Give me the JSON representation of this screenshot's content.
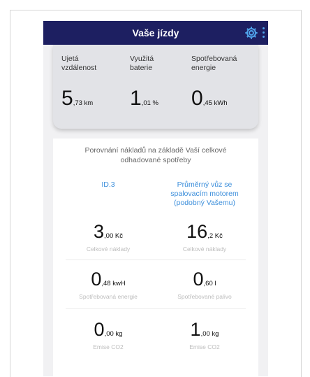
{
  "header": {
    "title": "Vaše jízdy",
    "settings_icon": "gear-icon",
    "more_icon": "kebab-menu-icon",
    "accent_color": "#4fa3ea",
    "bar_color": "#1d1f61"
  },
  "stats": [
    {
      "label_line1": "Ujetá",
      "label_line2": "vzdálenost",
      "value_big": "5",
      "value_small": ",73 km"
    },
    {
      "label_line1": "Využitá",
      "label_line2": "baterie",
      "value_big": "1",
      "value_small": ",01 %"
    },
    {
      "label_line1": "Spotřebovaná",
      "label_line2": "energie",
      "value_big": "0",
      "value_small": ",45 kWh"
    }
  ],
  "comparison": {
    "title_line1": "Porovnání nákladů na základě Vaší celkové",
    "title_line2": "odhadované spotřeby",
    "col1_heading": "ID.3",
    "col2_heading_line1": "Průměrný vůz se",
    "col2_heading_line2": "spalovacím motorem",
    "col2_heading_line3": "(podobný Vašemu)",
    "link_color": "#3b8edb",
    "rows": [
      {
        "left": {
          "value_big": "3",
          "value_small": ",00 Kč",
          "label": "Celkové náklady"
        },
        "right": {
          "value_big": "16",
          "value_small": ",2 Kč",
          "label": "Celkové náklady"
        }
      },
      {
        "left": {
          "value_big": "0",
          "value_small": ",48 kwH",
          "label": "Spotřebovaná energie"
        },
        "right": {
          "value_big": "0",
          "value_small": ",60 l",
          "label": "Spotřebované palivo"
        }
      },
      {
        "left": {
          "value_big": "0",
          "value_small": ",00 kg",
          "label": "Emise CO2"
        },
        "right": {
          "value_big": "1",
          "value_small": ",00 kg",
          "label": "Emise CO2"
        }
      }
    ]
  }
}
